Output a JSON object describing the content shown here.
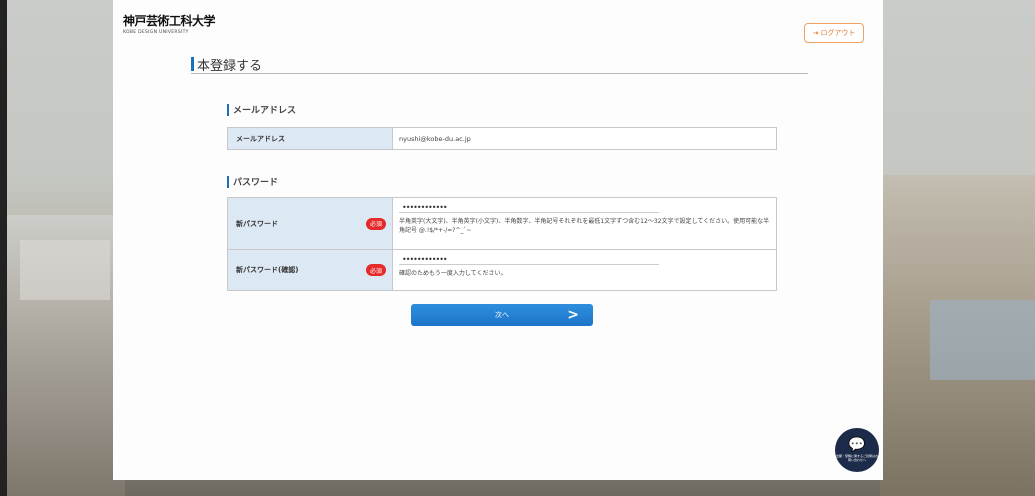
{
  "header": {
    "logo_jp": "神戸芸術工科大学",
    "logo_en": "KOBE DESIGN UNIVERSITY",
    "logout_label": "ログアウト",
    "logout_icon": "logout-icon"
  },
  "page": {
    "title": "本登録する"
  },
  "email_section": {
    "title": "メールアドレス",
    "label": "メールアドレス",
    "value": "nyushi@kobe-du.ac.jp"
  },
  "password_section": {
    "title": "パスワード",
    "new_label": "新パスワード",
    "new_required": "必須",
    "new_value": "••••••••••••",
    "new_hint": "半角英字(大文字)、半角英字(小文字)、半角数字、半角記号それぞれを最低1文字ずつ含む12～32文字で設定してください。使用可能な半角記号 @.!$/*+-/=?^_`~",
    "confirm_label": "新パスワード(確認)",
    "confirm_required": "必須",
    "confirm_value": "••••••••••••",
    "confirm_hint": "確認のためもう一度入力してください。"
  },
  "actions": {
    "next_label": "次へ",
    "next_icon": "chevron-right-icon"
  },
  "chat": {
    "icon": "chat-bubbles-icon",
    "label": "出願・受験に関するご質問はお問い合わせへ"
  },
  "colors": {
    "accent": "#1e6fb8",
    "button": "#1b75c9",
    "required": "#e52a2a",
    "label_bg": "#dde8f5",
    "logout": "#e07a35"
  }
}
